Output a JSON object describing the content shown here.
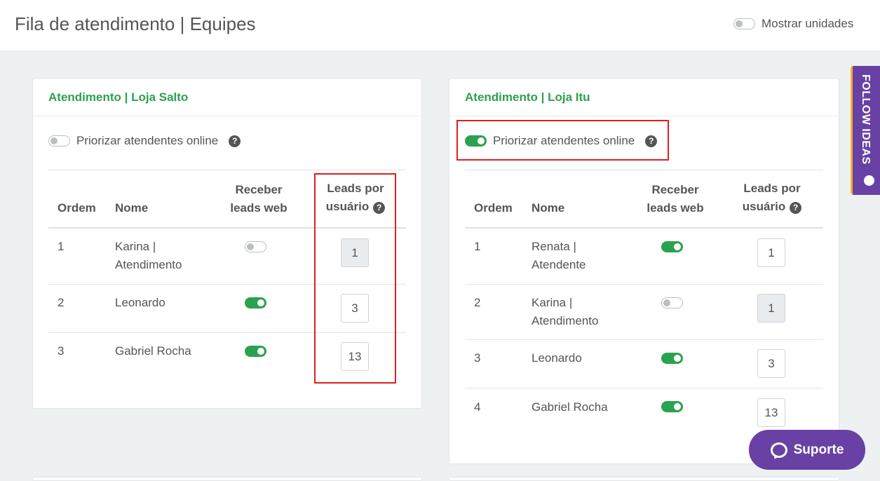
{
  "header": {
    "title": "Fila de atendimento | Equipes",
    "show_units_label": "Mostrar unidades",
    "show_units_on": false
  },
  "colors": {
    "accent_green": "#2aa24f",
    "purple": "#6941a5",
    "highlight_red": "#e01e1e"
  },
  "cards": [
    {
      "title": "Atendimento | Loja Salto",
      "prioritize_label": "Priorizar atendentes online",
      "prioritize_on": false,
      "help_icon": "?",
      "columns": {
        "order": "Ordem",
        "name": "Nome",
        "receive_1": "Receber",
        "receive_2": "leads web",
        "leads_1": "Leads por",
        "leads_2": "usuário"
      },
      "rows": [
        {
          "order": "1",
          "name_1": "Karina |",
          "name_2": "Atendimento",
          "receive_on": false,
          "leads": "1",
          "leads_disabled": true
        },
        {
          "order": "2",
          "name_1": "Leonardo",
          "name_2": "",
          "receive_on": true,
          "leads": "3",
          "leads_disabled": false
        },
        {
          "order": "3",
          "name_1": "Gabriel Rocha",
          "name_2": "",
          "receive_on": true,
          "leads": "13",
          "leads_disabled": false
        }
      ]
    },
    {
      "title": "Atendimento | Loja Itu",
      "prioritize_label": "Priorizar atendentes online",
      "prioritize_on": true,
      "help_icon": "?",
      "columns": {
        "order": "Ordem",
        "name": "Nome",
        "receive_1": "Receber",
        "receive_2": "leads web",
        "leads_1": "Leads por",
        "leads_2": "usuário"
      },
      "rows": [
        {
          "order": "1",
          "name_1": "Renata |",
          "name_2": "Atendente",
          "receive_on": true,
          "leads": "1",
          "leads_disabled": false
        },
        {
          "order": "2",
          "name_1": "Karina |",
          "name_2": "Atendimento",
          "receive_on": false,
          "leads": "1",
          "leads_disabled": true
        },
        {
          "order": "3",
          "name_1": "Leonardo",
          "name_2": "",
          "receive_on": true,
          "leads": "3",
          "leads_disabled": false
        },
        {
          "order": "4",
          "name_1": "Gabriel Rocha",
          "name_2": "",
          "receive_on": true,
          "leads": "13",
          "leads_disabled": false
        }
      ]
    }
  ],
  "side_tab": {
    "label": "FOLLOW IDEAS",
    "icon": "lightbulb-icon"
  },
  "support": {
    "label": "Suporte",
    "icon": "chat-bubble-icon"
  }
}
